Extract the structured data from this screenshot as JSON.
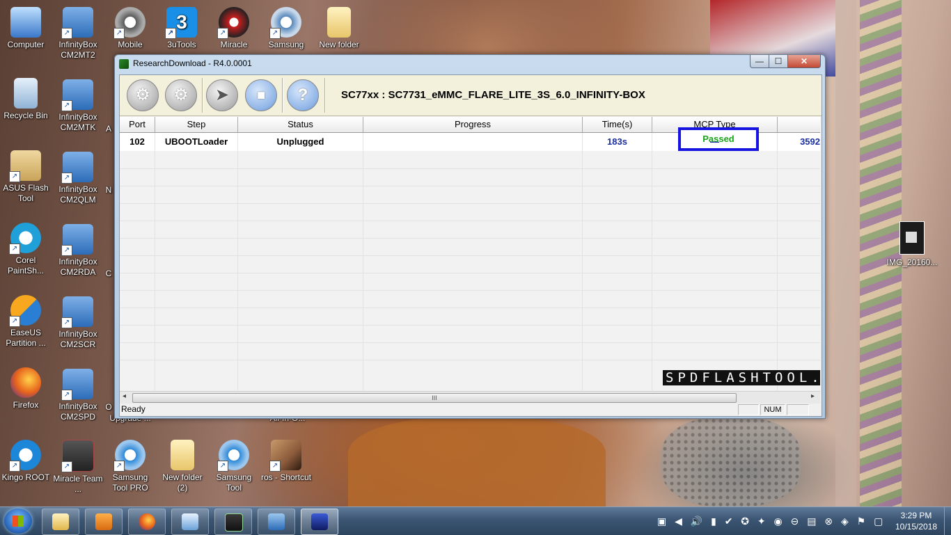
{
  "desktop_icons": [
    {
      "label": "Computer",
      "icon": "computer-icon",
      "color": "#3a78c9"
    },
    {
      "label": "InfinityBox CM2MT2",
      "icon": "infinitybox-icon",
      "color": "#2c6cb8"
    },
    {
      "label": "Mobile",
      "icon": "gear-icon",
      "color": "#5a5a5a"
    },
    {
      "label": "3uTools",
      "icon": "3utools-icon",
      "color": "#1a8fe8"
    },
    {
      "label": "Miracle",
      "icon": "miracle-icon",
      "color": "#c81e1e"
    },
    {
      "label": "Samsung",
      "icon": "gear-icon",
      "color": "#5588bb"
    },
    {
      "label": "New folder",
      "icon": "folder-icon",
      "color": "#e8c66a"
    },
    {
      "label": "Recycle Bin",
      "icon": "recycle-bin-icon",
      "color": "#8fb3d6"
    },
    {
      "label": "InfinityBox CM2MTK",
      "icon": "infinitybox-icon",
      "color": "#2c6cb8"
    },
    {
      "label": "ASUS Flash Tool",
      "icon": "package-icon",
      "color": "#c9a45a"
    },
    {
      "label": "InfinityBox CM2QLM",
      "icon": "infinitybox-icon",
      "color": "#2c6cb8"
    },
    {
      "label": "Corel PaintSh...",
      "icon": "camera-icon",
      "color": "#1fa0d8"
    },
    {
      "label": "InfinityBox CM2RDA",
      "icon": "infinitybox-icon",
      "color": "#2c6cb8"
    },
    {
      "label": "EaseUS Partition ...",
      "icon": "easeus-icon",
      "color": "#2a7fd4"
    },
    {
      "label": "InfinityBox CM2SCR",
      "icon": "infinitybox-icon",
      "color": "#2c6cb8"
    },
    {
      "label": "Firefox",
      "icon": "firefox-icon",
      "color": "#e8641c"
    },
    {
      "label": "InfinityBox CM2SPD",
      "icon": "infinitybox-icon",
      "color": "#2c6cb8"
    },
    {
      "label": "Kingo ROOT",
      "icon": "kingo-root-icon",
      "color": "#1c86d8"
    },
    {
      "label": "Miracle Team ...",
      "icon": "miracle-team-icon",
      "color": "#3a3a3a"
    },
    {
      "label": "Samsung Tool PRO",
      "icon": "gear-icon",
      "color": "#2f8ad8"
    },
    {
      "label": "New folder (2)",
      "icon": "folder-icon",
      "color": "#e8c66a"
    },
    {
      "label": "Samsung Tool",
      "icon": "gear-icon",
      "color": "#2f8ad8"
    },
    {
      "label": "ros - Shortcut",
      "icon": "game-icon",
      "color": "#8a5a3a"
    }
  ],
  "partial_labels": {
    "a": "A",
    "n": "N",
    "c": "C",
    "o": "O",
    "upgrade": "Upgrade ...",
    "allinone": "All-In-O..."
  },
  "image_file": {
    "label": "IMG_20160..."
  },
  "window": {
    "title": "ResearchDownload - R4.0.0001",
    "min": "—",
    "max": "☐",
    "close": "✕",
    "toolbar_title": "SC77xx : SC7731_eMMC_FLARE_LITE_3S_6.0_INFINITY-BOX",
    "columns": [
      "Port",
      "Step",
      "Status",
      "Progress",
      "Time(s)",
      "MCP Type",
      ""
    ],
    "rows": [
      {
        "port": "102",
        "step": "UBOOTLoader",
        "status": "Unplugged",
        "progress": "Passed",
        "time": "183s",
        "mcp": "—",
        "extra": "3592"
      }
    ],
    "watermark": "SPDFLASHTOOL.COM",
    "scroll_grip": "III",
    "scroll_left": "◂",
    "scroll_right": "▸",
    "status_text": "Ready",
    "num": "NUM",
    "colors": {
      "passed": "#1aa41a",
      "highlight_box": "#1515e0",
      "time": "#1a2ea0"
    }
  },
  "taskbar": {
    "items": [
      "explorer-icon",
      "media-player-icon",
      "firefox-icon",
      "search-tool-icon",
      "console-icon",
      "spd-tool-icon",
      "flash-tool-icon"
    ],
    "time": "3:29 PM",
    "date": "10/15/2018"
  }
}
